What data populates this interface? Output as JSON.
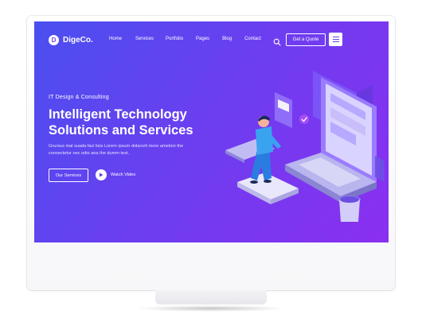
{
  "header": {
    "logo_mark": "D",
    "logo_text": "DigeCo.",
    "nav": [
      "Home",
      "Services",
      "Portfolio",
      "Pages",
      "Blog",
      "Contact"
    ],
    "search_icon": "search-icon",
    "cta_label": "Get a Quote",
    "menu_icon": "hamburger-icon"
  },
  "hero": {
    "eyebrow": "IT Design & Consulting",
    "title_line1": "Intelligent Technology",
    "title_line2": "Solutions and Services",
    "description": "Grursus mal suada faci lisis Lorem ipsum dolarorit more ametion the consectetur nec odio aea the dumm text.",
    "primary_button": "Our Services",
    "video_label": "Watch Video",
    "video_icon": "play-icon"
  },
  "colors": {
    "gradient_start": "#4a4ff0",
    "gradient_end": "#8b2ff0",
    "accent": "#6b3ff0"
  }
}
